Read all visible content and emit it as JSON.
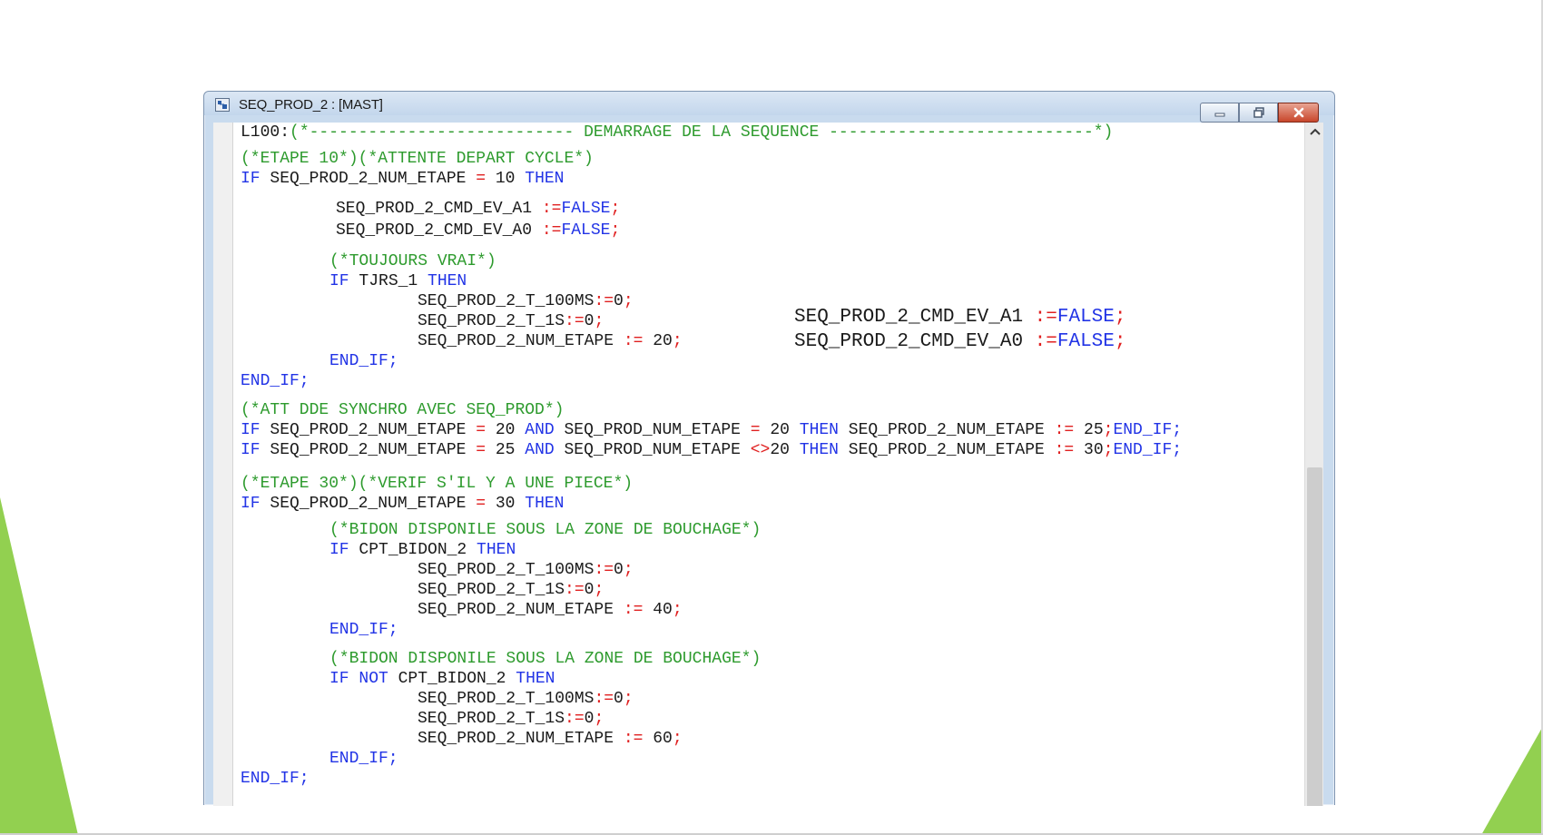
{
  "window": {
    "title": "SEQ_PROD_2 : [MAST]",
    "icon": "program-section-icon"
  },
  "colors": {
    "keyword": "#2234e6",
    "comment": "#2e9b2e",
    "operator": "#e02020",
    "text": "#1a1a1a",
    "accent": "#92d050"
  },
  "code": {
    "l1": {
      "a": "L100:",
      "b": "(*--------------------------- DEMARRAGE DE LA SEQUENCE ---------------------------*)"
    },
    "l2": {
      "a": "(*ETAPE 10*)(*ATTENTE DEPART CYCLE*)"
    },
    "l3": {
      "a": "IF",
      "b": " SEQ_PROD_2_NUM_ETAPE ",
      "c": "=",
      "d": " 10 ",
      "e": "THEN"
    },
    "l4": {
      "a": "SEQ_PROD_2_CMD_EV_A1 ",
      "b": ":=",
      "c": "FALSE",
      "d": ";"
    },
    "l5": {
      "a": "SEQ_PROD_2_CMD_EV_A0 ",
      "b": ":=",
      "c": "FALSE",
      "d": ";"
    },
    "l6": {
      "a": "(*TOUJOURS VRAI*)"
    },
    "l7": {
      "a": "IF",
      "b": " TJRS_1 ",
      "c": "THEN"
    },
    "l8": {
      "a": "SEQ_PROD_2_T_100MS",
      "b": ":=",
      "c": "0",
      "d": ";"
    },
    "l9": {
      "a": "SEQ_PROD_2_T_1S",
      "b": ":=",
      "c": "0",
      "d": ";"
    },
    "l10": {
      "a": "SEQ_PROD_2_NUM_ETAPE ",
      "b": ":=",
      "c": " 20",
      "d": ";"
    },
    "l11": {
      "a": "END_IF;"
    },
    "l12": {
      "a": "END_IF;"
    },
    "l13": {
      "a": "(*ATT DDE SYNCHRO AVEC SEQ_PROD*)"
    },
    "l14": {
      "a": "IF",
      "b": " SEQ_PROD_2_NUM_ETAPE ",
      "c": "=",
      "d": " 20 ",
      "e": "AND",
      "f": " SEQ_PROD_NUM_ETAPE ",
      "g": "=",
      "h": " 20 ",
      "i": "THEN",
      "j": " SEQ_PROD_2_NUM_ETAPE ",
      "k": ":=",
      "l": " 25",
      "m": ";",
      "n": "END_IF;"
    },
    "l15": {
      "a": "IF",
      "b": " SEQ_PROD_2_NUM_ETAPE ",
      "c": "=",
      "d": " 25 ",
      "e": "AND",
      "f": " SEQ_PROD_NUM_ETAPE ",
      "g": "<>",
      "h": "20 ",
      "i": "THEN",
      "j": " SEQ_PROD_2_NUM_ETAPE ",
      "k": ":=",
      "l": " 30",
      "m": ";",
      "n": "END_IF;"
    },
    "l16": {
      "a": "(*ETAPE 30*)(*VERIF S'IL Y A UNE PIECE*)"
    },
    "l17": {
      "a": "IF",
      "b": " SEQ_PROD_2_NUM_ETAPE ",
      "c": "=",
      "d": " 30 ",
      "e": "THEN"
    },
    "l18": {
      "a": "(*BIDON DISPONILE SOUS LA ZONE DE BOUCHAGE*)"
    },
    "l19": {
      "a": "IF",
      "b": " CPT_BIDON_2 ",
      "c": "THEN"
    },
    "l20": {
      "a": "SEQ_PROD_2_T_100MS",
      "b": ":=",
      "c": "0",
      "d": ";"
    },
    "l21": {
      "a": "SEQ_PROD_2_T_1S",
      "b": ":=",
      "c": "0",
      "d": ";"
    },
    "l22": {
      "a": "SEQ_PROD_2_NUM_ETAPE ",
      "b": ":=",
      "c": " 40",
      "d": ";"
    },
    "l23": {
      "a": "END_IF;"
    },
    "l24": {
      "a": "(*BIDON DISPONILE SOUS LA ZONE DE BOUCHAGE*)"
    },
    "l25": {
      "a": "IF",
      "b": " NOT",
      "c": " CPT_BIDON_2 ",
      "d": "THEN"
    },
    "l26": {
      "a": "SEQ_PROD_2_T_100MS",
      "b": ":=",
      "c": "0",
      "d": ";"
    },
    "l27": {
      "a": "SEQ_PROD_2_T_1S",
      "b": ":=",
      "c": "0",
      "d": ";"
    },
    "l28": {
      "a": "SEQ_PROD_2_NUM_ETAPE ",
      "b": ":=",
      "c": " 60",
      "d": ";"
    },
    "l29": {
      "a": "END_IF;"
    },
    "l30": {
      "a": "END_IF;"
    }
  },
  "overlay": {
    "o1": {
      "a": "SEQ_PROD_2_CMD_EV_A1 ",
      "b": ":=",
      "c": "FALSE",
      "d": ";"
    },
    "o2": {
      "a": "SEQ_PROD_2_CMD_EV_A0 ",
      "b": ":=",
      "c": "FALSE",
      "d": ";"
    }
  }
}
